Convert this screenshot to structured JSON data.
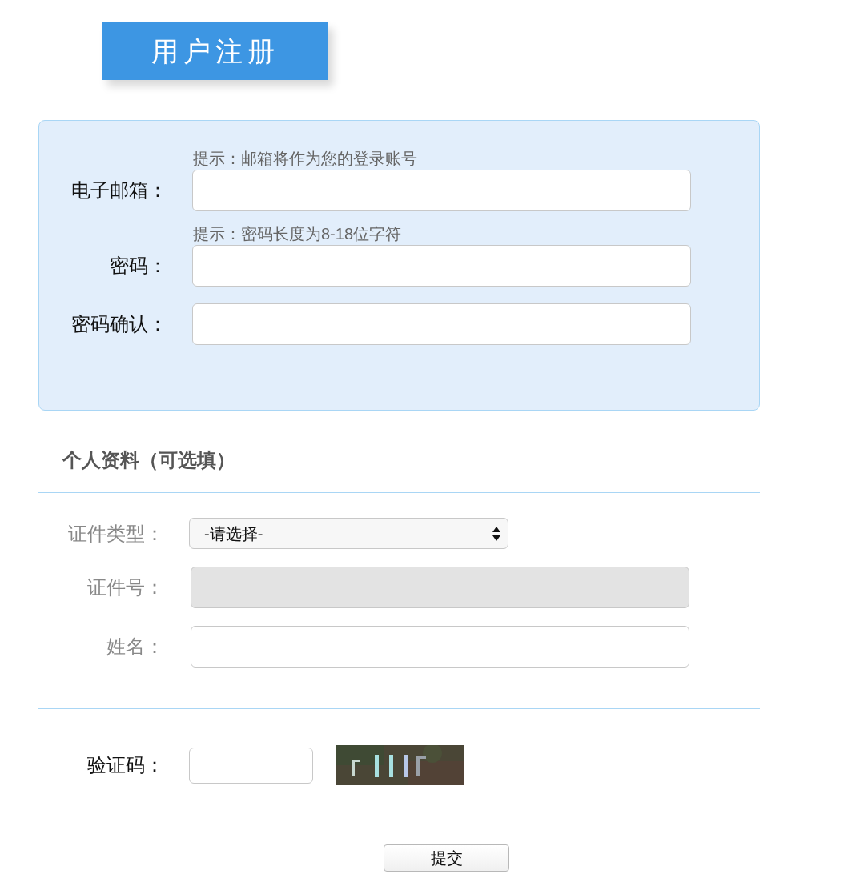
{
  "banner": {
    "title": "用户注册"
  },
  "account_fields": [
    {
      "label": "电子邮箱：",
      "hint": "提示：邮箱将作为您的登录账号"
    },
    {
      "label": "密码：",
      "hint": "提示：密码长度为8-18位字符"
    },
    {
      "label": "密码确认："
    }
  ],
  "profile": {
    "title": "个人资料（可选填）",
    "fields": [
      {
        "kind": "select",
        "label": "证件类型：",
        "value": "-请选择-"
      },
      {
        "kind": "text",
        "label": "证件号：",
        "disabled": true
      },
      {
        "kind": "text",
        "label": "姓名：",
        "disabled": false
      }
    ]
  },
  "captcha": {
    "label": "验证码："
  },
  "submit": "提交"
}
